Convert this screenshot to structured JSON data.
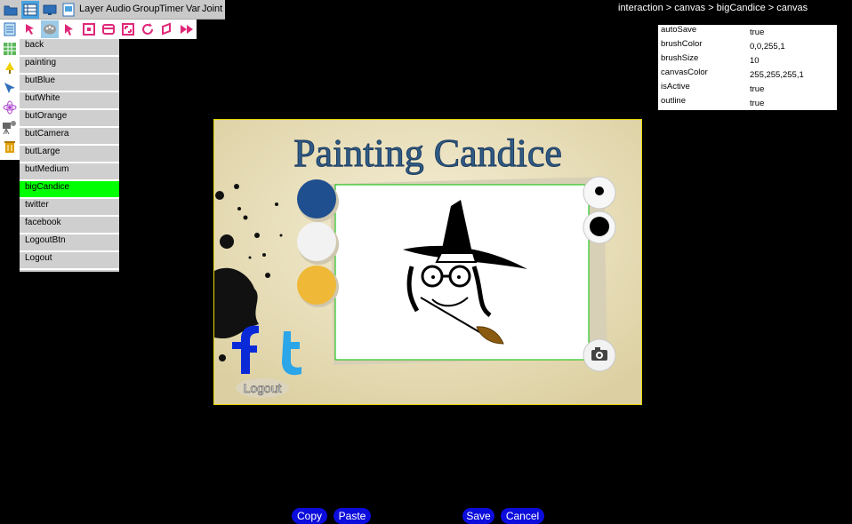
{
  "toolbar": {
    "menu": [
      "Layer",
      "Audio",
      "Group",
      "Timer",
      "Var",
      "Joint"
    ]
  },
  "breadcrumb": "interaction > canvas > bigCandice > canvas",
  "objects": [
    {
      "label": "back",
      "selected": false
    },
    {
      "label": "painting",
      "selected": false
    },
    {
      "label": "butBlue",
      "selected": false
    },
    {
      "label": "butWhite",
      "selected": false
    },
    {
      "label": "butOrange",
      "selected": false
    },
    {
      "label": "butCamera",
      "selected": false
    },
    {
      "label": "butLarge",
      "selected": false
    },
    {
      "label": "butMedium",
      "selected": false
    },
    {
      "label": "bigCandice",
      "selected": true
    },
    {
      "label": "twitter",
      "selected": false
    },
    {
      "label": "facebook",
      "selected": false
    },
    {
      "label": "LogoutBtn",
      "selected": false
    },
    {
      "label": "Logout",
      "selected": false
    }
  ],
  "properties": [
    {
      "name": "autoSave",
      "value": "true"
    },
    {
      "name": "brushColor",
      "value": "0,0,255,1"
    },
    {
      "name": "brushSize",
      "value": "10"
    },
    {
      "name": "canvasColor",
      "value": "255,255,255,1"
    },
    {
      "name": "isActive",
      "value": "true"
    },
    {
      "name": "outline",
      "value": "true"
    }
  ],
  "game": {
    "title": "Painting Candice",
    "logout_label": "Logout",
    "colors": {
      "blue": "#1f4f8e",
      "white": "#f2f2f2",
      "orange": "#efb836",
      "canvas_outline": "#00c000"
    }
  },
  "buttons": {
    "copy": "Copy",
    "paste": "Paste",
    "save": "Save",
    "cancel": "Cancel"
  }
}
